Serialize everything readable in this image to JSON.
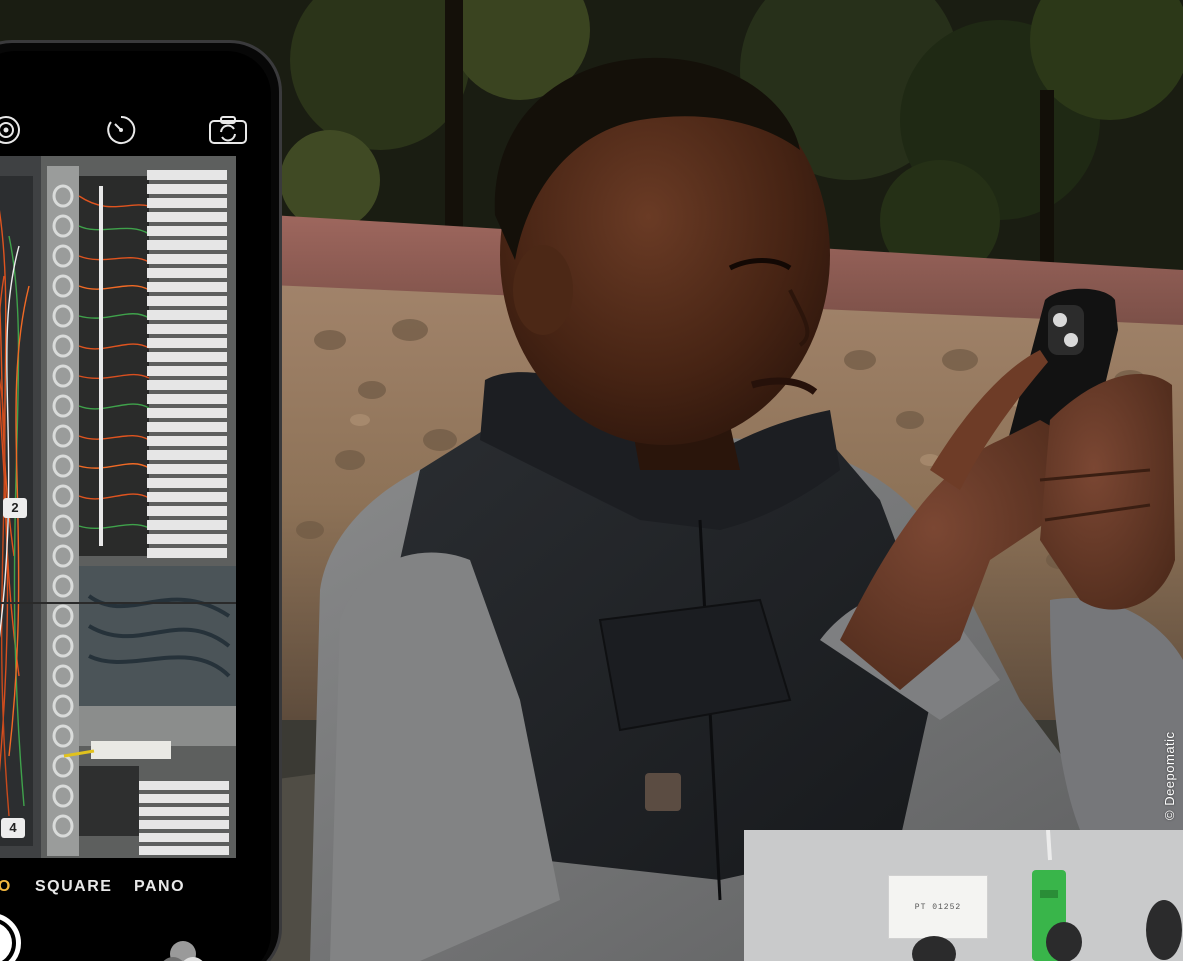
{
  "photo": {
    "subject": "man photographing with smartphone",
    "background": "stone wall with trees"
  },
  "phone": {
    "top_icons": [
      "live-photo-icon",
      "timer-icon",
      "flip-camera-icon"
    ],
    "rack_labels": [
      "2",
      "4"
    ],
    "modes": {
      "photo": "OTO",
      "square": "SQUARE",
      "pano": "PANO"
    },
    "active_mode_color": "#f2b73f"
  },
  "inset": {
    "label_text": "PT 01252",
    "connector_color": "#39b54a"
  },
  "credit": "© Deepomatic"
}
